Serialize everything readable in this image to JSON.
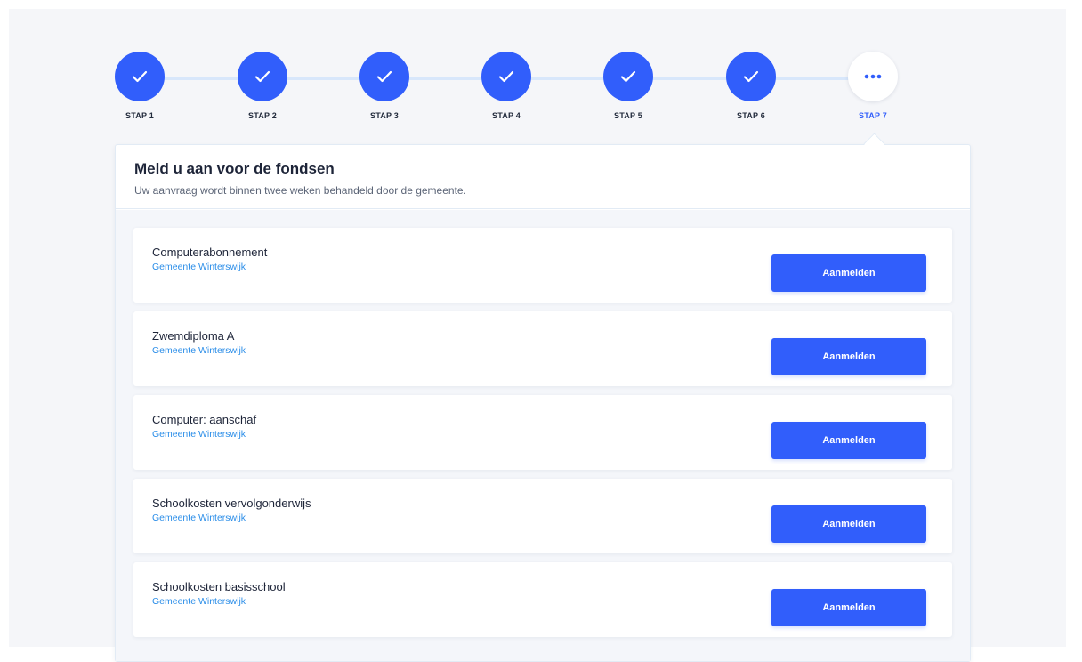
{
  "stepper": {
    "steps": [
      {
        "label": "STAP 1",
        "state": "done"
      },
      {
        "label": "STAP 2",
        "state": "done"
      },
      {
        "label": "STAP 3",
        "state": "done"
      },
      {
        "label": "STAP 4",
        "state": "done"
      },
      {
        "label": "STAP 5",
        "state": "done"
      },
      {
        "label": "STAP 6",
        "state": "done"
      },
      {
        "label": "STAP 7",
        "state": "current"
      }
    ],
    "done_icon": "check-icon",
    "current_icon": "more-dots-icon"
  },
  "card": {
    "title": "Meld u aan voor de fondsen",
    "subtitle": "Uw aanvraag wordt binnen twee weken behandeld door de gemeente."
  },
  "funds": [
    {
      "name": "Computerabonnement",
      "organization": "Gemeente Winterswijk",
      "button_label": "Aanmelden"
    },
    {
      "name": "Zwemdiploma A",
      "organization": "Gemeente Winterswijk",
      "button_label": "Aanmelden"
    },
    {
      "name": "Computer: aanschaf",
      "organization": "Gemeente Winterswijk",
      "button_label": "Aanmelden"
    },
    {
      "name": "Schoolkosten vervolgonderwijs",
      "organization": "Gemeente Winterswijk",
      "button_label": "Aanmelden"
    },
    {
      "name": "Schoolkosten basisschool",
      "organization": "Gemeente Winterswijk",
      "button_label": "Aanmelden"
    }
  ],
  "colors": {
    "accent": "#315efb",
    "link": "#2a8de8",
    "step_line": "#d8e7fb",
    "background": "#f5f6f9"
  }
}
